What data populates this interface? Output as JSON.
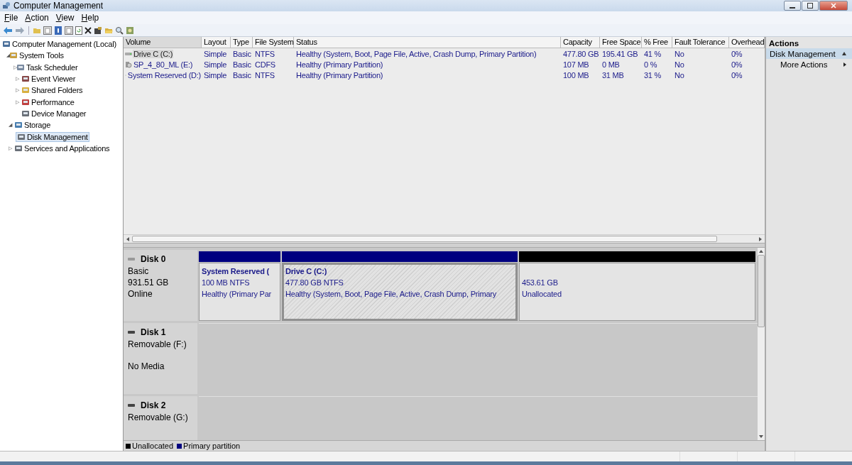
{
  "window": {
    "title": "Computer Management"
  },
  "menu": [
    "File",
    "Action",
    "View",
    "Help"
  ],
  "tree": [
    {
      "label": "Computer Management (Local)",
      "selected": false,
      "children": [
        {
          "label": "System Tools",
          "expander": "◢",
          "selected": false,
          "children": [
            {
              "label": "Task Scheduler",
              "expander": "▷",
              "selected": false
            },
            {
              "label": "Event Viewer",
              "expander": "▷",
              "selected": false
            },
            {
              "label": "Shared Folders",
              "expander": "▷",
              "selected": false
            },
            {
              "label": "Performance",
              "expander": "▷",
              "selected": false
            },
            {
              "label": "Device Manager",
              "selected": false
            }
          ]
        },
        {
          "label": "Storage",
          "expander": "◢",
          "selected": false,
          "children": [
            {
              "label": "Disk Management",
              "selected": true
            }
          ]
        },
        {
          "label": "Services and Applications",
          "expander": "▷",
          "selected": false
        }
      ]
    }
  ],
  "volumes": {
    "columns": [
      "Volume",
      "Layout",
      "Type",
      "File System",
      "Status",
      "Capacity",
      "Free Space",
      "% Free",
      "Fault Tolerance",
      "Overhead"
    ],
    "rows": [
      {
        "selected": true,
        "kind": "drive",
        "cells": [
          "Drive C (C:)",
          "Simple",
          "Basic",
          "NTFS",
          "Healthy (System, Boot, Page File, Active, Crash Dump, Primary Partition)",
          "477.80 GB",
          "195.41 GB",
          "41 %",
          "No",
          "0%"
        ]
      },
      {
        "selected": false,
        "kind": "cd",
        "cells": [
          "SP_4_80_ML (E:)",
          "Simple",
          "Basic",
          "CDFS",
          "Healthy (Primary Partition)",
          "107 MB",
          "0 MB",
          "0 %",
          "No",
          "0%"
        ]
      },
      {
        "selected": false,
        "kind": "drive",
        "cells": [
          "System Reserved (D:)",
          "Simple",
          "Basic",
          "NTFS",
          "Healthy (Primary Partition)",
          "100 MB",
          "31 MB",
          "31 %",
          "No",
          "0%"
        ]
      }
    ]
  },
  "disks": [
    {
      "name": "Disk 0",
      "lines": [
        "Basic",
        "931.51 GB",
        "Online"
      ],
      "partitions": [
        {
          "kind": "primary",
          "selected": false,
          "title": "System Reserved  (",
          "lines": [
            "100 MB NTFS",
            "Healthy (Primary Par"
          ]
        },
        {
          "kind": "primary",
          "selected": true,
          "title": "Drive C  (C:)",
          "lines": [
            "477.80 GB NTFS",
            "Healthy (System, Boot, Page File, Active, Crash Dump, Primary"
          ]
        },
        {
          "kind": "unallocated",
          "selected": false,
          "lines": [
            "453.61 GB",
            "Unallocated"
          ]
        }
      ]
    },
    {
      "name": "Disk 1",
      "lines": [
        "Removable (F:)",
        "No Media"
      ]
    },
    {
      "name": "Disk 2",
      "lines": [
        "Removable (G:)"
      ]
    }
  ],
  "legend": [
    {
      "kind": "unallocated",
      "label": "Unallocated",
      "color": "#000000"
    },
    {
      "kind": "primary",
      "label": "Primary partition",
      "color": "#000080"
    }
  ],
  "actions": {
    "title": "Actions",
    "section": {
      "label": "Disk Management",
      "expanded": true
    },
    "items": [
      {
        "label": "More Actions"
      }
    ]
  }
}
